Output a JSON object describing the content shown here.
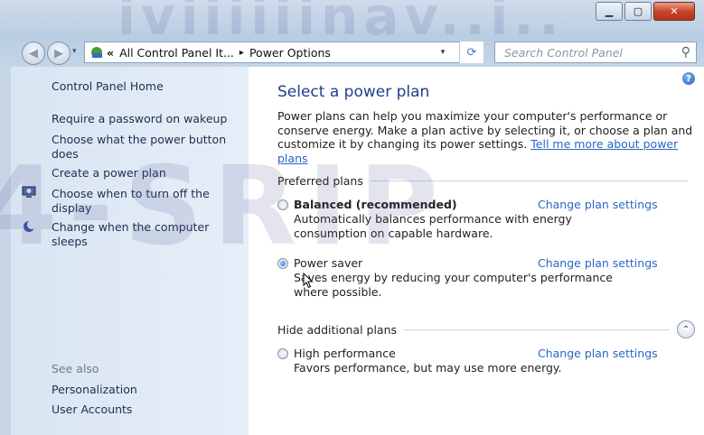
{
  "window": {
    "minimize_glyph": "▁",
    "maximize_glyph": "▢",
    "close_glyph": "✕"
  },
  "address": {
    "back_glyph": "◀",
    "forward_glyph": "▶",
    "arrow_glyph": "▾",
    "chevrons": "«",
    "crumb_1": "All Control Panel It...",
    "sep": "▸",
    "crumb_2": "Power Options",
    "refresh_glyph": "⟳",
    "search_placeholder": "Search Control Panel"
  },
  "watermark": {
    "top": "iviiiiiinav..i..",
    "big": "4-SRIP"
  },
  "sidebar": {
    "home": "Control Panel Home",
    "links": [
      "Require a password on wakeup",
      "Choose what the power button does",
      "Create a power plan",
      "Choose when to turn off the display",
      "Change when the computer sleeps"
    ],
    "see_also": "See also",
    "see_also_links": [
      "Personalization",
      "User Accounts"
    ]
  },
  "main": {
    "help_glyph": "?",
    "heading": "Select a power plan",
    "intro": "Power plans can help you maximize your computer's performance or conserve energy. Make a plan active by selecting it, or choose a plan and customize it by changing its power settings. ",
    "intro_link": "Tell me more about power plans",
    "preferred_label": "Preferred plans",
    "plans": [
      {
        "name": "Balanced (recommended)",
        "desc": "Automatically balances performance with energy consumption on capable hardware.",
        "change": "Change plan settings"
      },
      {
        "name": "Power saver",
        "desc": "Saves energy by reducing your computer's performance where possible.",
        "change": "Change plan settings"
      }
    ],
    "additional_label": "Hide additional plans",
    "collapse_glyph": "⌃",
    "additional_plans": [
      {
        "name": "High performance",
        "desc": "Favors performance, but may use more energy.",
        "change": "Change plan settings"
      }
    ]
  }
}
